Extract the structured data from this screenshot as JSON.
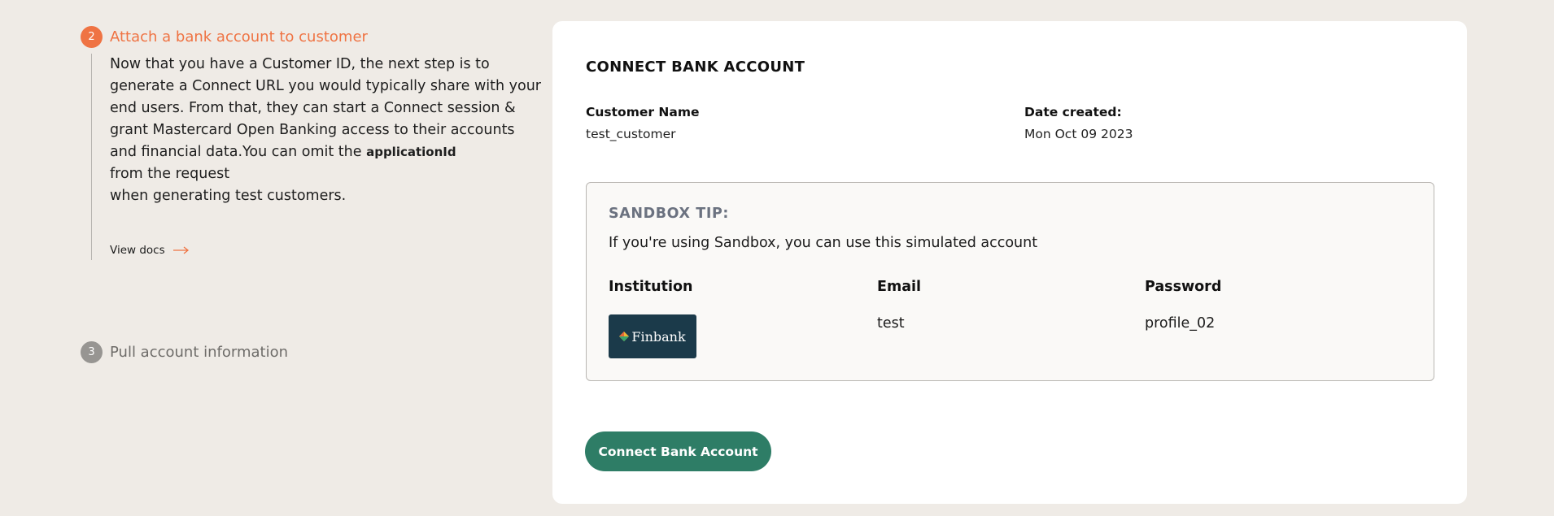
{
  "steps": [
    {
      "number": "2",
      "title": "Attach a bank account to customer",
      "description_part1": "Now that you have a Customer ID, the next step is to generate a Connect URL you would typically share with your end users. From that, they can start a Connect session & grant Mastercard Open Banking access to their accounts and financial data.You can omit the ",
      "description_code": "applicationId",
      "description_part2": "from the request",
      "description_part3": "when generating test customers.",
      "link_label": "View docs"
    },
    {
      "number": "3",
      "title": "Pull account information"
    }
  ],
  "card": {
    "title": "CONNECT BANK ACCOUNT",
    "customer_name_label": "Customer Name",
    "customer_name_value": "test_customer",
    "date_created_label": "Date created:",
    "date_created_value": "Mon Oct 09 2023",
    "tip": {
      "title": "SANDBOX TIP:",
      "text": "If you're using Sandbox, you can use this simulated account",
      "columns": [
        "Institution",
        "Email",
        "Password"
      ],
      "institution_logo_text": "Finbank",
      "email": "test",
      "password": "profile_02"
    },
    "button_label": "Connect Bank Account"
  },
  "colors": {
    "accent": "#ef7343",
    "primary_button": "#2e7d66",
    "background": "#efebe6",
    "finbank_bg": "#1b3a4a"
  },
  "icons": [
    "arrow-right-icon",
    "finbank-diamond-icon"
  ]
}
